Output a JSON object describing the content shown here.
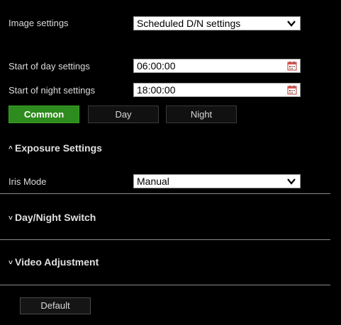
{
  "image_settings": {
    "label": "Image settings",
    "selected": "Scheduled D/N settings"
  },
  "schedule": {
    "start_day_label": "Start of day settings",
    "start_day_value": "06:00:00",
    "start_night_label": "Start of night settings",
    "start_night_value": "18:00:00"
  },
  "tabs": [
    {
      "label": "Common",
      "active": true
    },
    {
      "label": "Day",
      "active": false
    },
    {
      "label": "Night",
      "active": false
    }
  ],
  "exposure": {
    "title": "Exposure Settings",
    "expanded": true,
    "iris_mode_label": "Iris Mode",
    "iris_mode_value": "Manual"
  },
  "day_night_switch": {
    "title": "Day/Night Switch",
    "expanded": false
  },
  "video_adjustment": {
    "title": "Video Adjustment",
    "expanded": false
  },
  "default_button": "Default",
  "colors": {
    "background": "#000000",
    "active_tab": "#2e8b1d",
    "calendar_icon": "#c0392b"
  },
  "icons": {
    "dropdown": "chevron-down-icon",
    "calendar": "calendar-icon",
    "expanded": "caret-up-icon",
    "collapsed": "caret-down-icon"
  }
}
